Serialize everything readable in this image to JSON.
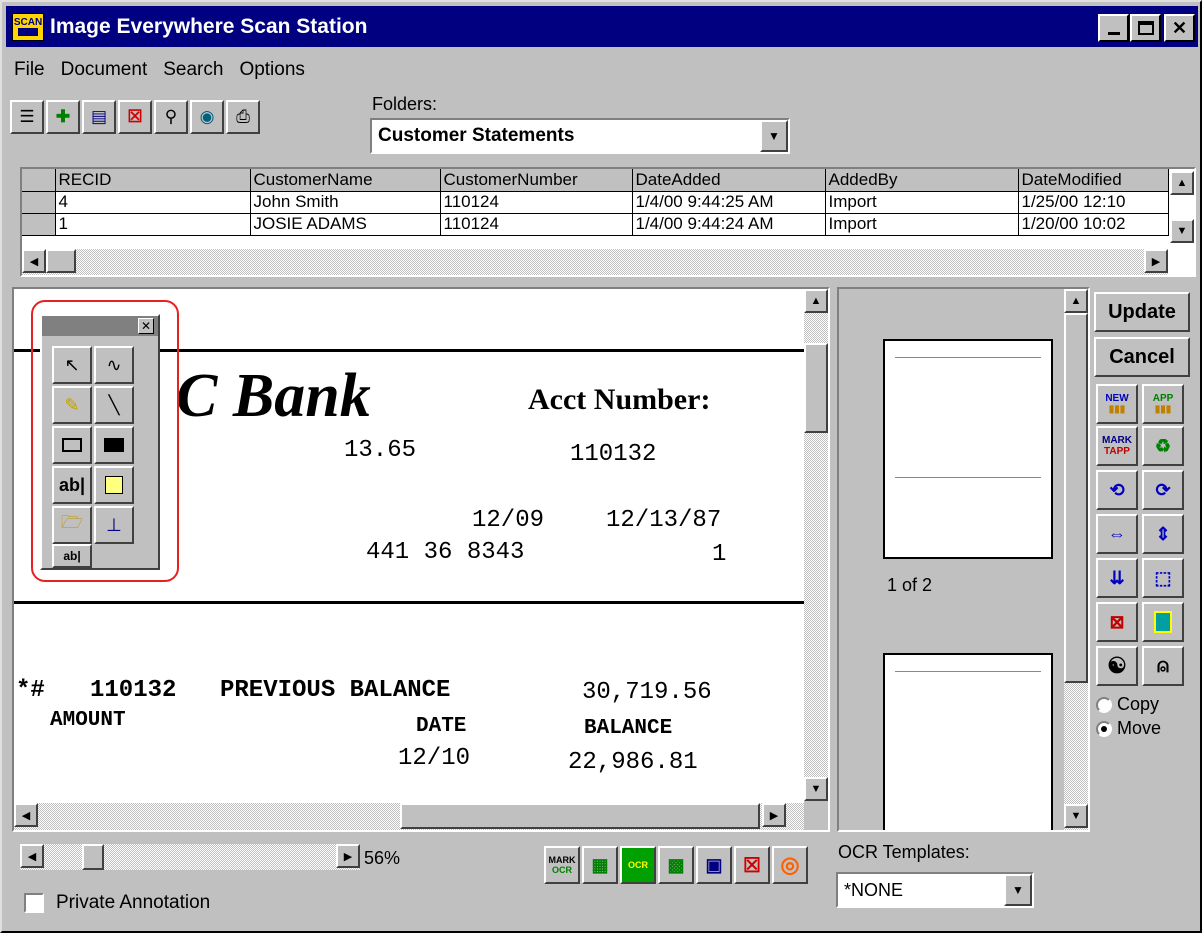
{
  "window": {
    "title": "Image Everywhere Scan Station",
    "icon_text": "SCAN",
    "controls": [
      "minimize-icon",
      "maximize-icon",
      "close-icon"
    ]
  },
  "menu": [
    "File",
    "Document",
    "Search",
    "Options"
  ],
  "toolbar": {
    "buttons": [
      "new-document-icon",
      "add-icon",
      "scan-icon",
      "delete-icon",
      "find-icon",
      "search-icon",
      "print-icon"
    ],
    "folders_label": "Folders:",
    "folders_value": "Customer Statements"
  },
  "grid": {
    "columns": [
      "RECID",
      "CustomerName",
      "CustomerNumber",
      "DateAdded",
      "AddedBy",
      "DateModified"
    ],
    "rows": [
      [
        "4",
        "John Smith",
        "110124",
        "1/4/00 9:44:25 AM",
        "Import",
        "1/25/00 12:10"
      ],
      [
        "1",
        "JOSIE ADAMS",
        "110124",
        "1/4/00 9:44:24 AM",
        "Import",
        "1/20/00 10:02"
      ]
    ]
  },
  "document": {
    "bank": "C Bank",
    "acct_label": "Acct Number:",
    "v1": "13.65",
    "v2": "110132",
    "d1": "12/09",
    "d2": "12/13/87",
    "ssn": "441 36 8343",
    "n1": "1",
    "prev_mark": "*#",
    "prev_num": "110132",
    "prev_label": "PREVIOUS BALANCE",
    "prev_amt": "30,719.56",
    "amount_label": "AMOUNT",
    "date_label": "DATE",
    "balance_label": "BALANCE",
    "d3": "12/10",
    "bal": "22,986.81"
  },
  "annotation_palette": {
    "tools": [
      "pointer-icon",
      "freehand-icon",
      "highlighter-icon",
      "line-icon",
      "rectangle-icon",
      "filled-rectangle-icon",
      "text-icon",
      "sticky-note-icon",
      "attach-icon",
      "stamp-icon",
      "linked-text-icon"
    ],
    "tools_text": {
      "text": "ab|",
      "linked": "ab|"
    }
  },
  "thumbnails": {
    "page_indicator": "1 of 2"
  },
  "right_panel": {
    "update": "Update",
    "cancel": "Cancel",
    "new": "NEW",
    "app": "APP",
    "mark": "MARK",
    "tapp": "TAPP",
    "copy": "Copy",
    "move": "Move",
    "selected": "Move"
  },
  "status": {
    "zoom": "56%",
    "private_annotation": "Private Annotation",
    "ocr_label": "OCR Templates:",
    "ocr_value": "*NONE",
    "mark_top": "MARK",
    "mark_bottom": "OCR",
    "ocr_icon_text": "OCR"
  }
}
